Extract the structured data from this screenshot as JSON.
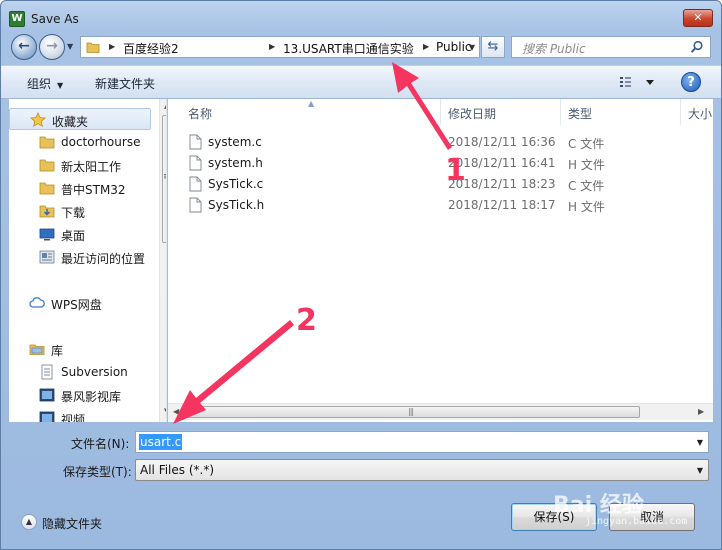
{
  "window": {
    "title": "Save As",
    "app_icon_label": "W"
  },
  "address": {
    "segments": [
      "百度经验2",
      "13.USART串口通信实验",
      "Public"
    ]
  },
  "search": {
    "placeholder": "搜索 Public"
  },
  "toolbar": {
    "organize_label": "组织",
    "new_folder_label": "新建文件夹",
    "help_label": "?"
  },
  "nav": {
    "favorites_label": "收藏夹",
    "items": [
      {
        "label": "doctorhourse",
        "icon": "folder-icon"
      },
      {
        "label": "新太阳工作",
        "icon": "folder-icon"
      },
      {
        "label": "普中STM32",
        "icon": "folder-icon"
      },
      {
        "label": "下载",
        "icon": "download-folder-icon"
      },
      {
        "label": "桌面",
        "icon": "desktop-icon"
      },
      {
        "label": "最近访问的位置",
        "icon": "recent-places-icon"
      }
    ],
    "wps_label": "WPS网盘",
    "libraries_label": "库",
    "library_items": [
      {
        "label": "Subversion",
        "icon": "library-doc-icon"
      },
      {
        "label": "暴风影视库",
        "icon": "library-video-icon"
      },
      {
        "label": "视频",
        "icon": "library-video-icon"
      }
    ]
  },
  "columns": {
    "name": "名称",
    "date": "修改日期",
    "type": "类型",
    "size": "大小"
  },
  "files": [
    {
      "name": "system.c",
      "date": "2018/12/11 16:36",
      "type": "C 文件"
    },
    {
      "name": "system.h",
      "date": "2018/12/11 16:41",
      "type": "H 文件"
    },
    {
      "name": "SysTick.c",
      "date": "2018/12/11 18:23",
      "type": "C 文件"
    },
    {
      "name": "SysTick.h",
      "date": "2018/12/11 18:17",
      "type": "H 文件"
    }
  ],
  "form": {
    "filename_label": "文件名(N):",
    "filename_value": "usart.c",
    "filetype_label": "保存类型(T):",
    "filetype_value": "All Files (*.*)",
    "hide_folders_label": "隐藏文件夹",
    "save_label": "保存(S)",
    "cancel_label": "取消"
  },
  "annotations": {
    "arrow1_label": "1",
    "arrow2_label": "2",
    "color": "#f5345f"
  },
  "watermark": {
    "text": "Bai 经验",
    "sub": "jingyan.baidu.com"
  }
}
